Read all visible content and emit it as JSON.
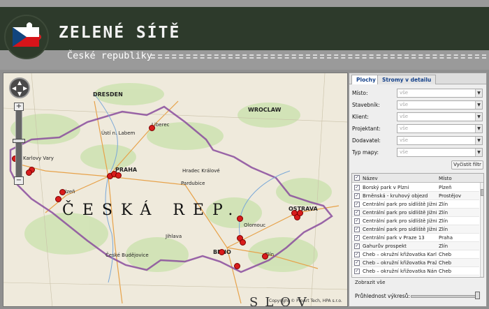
{
  "header": {
    "title": "ZELENÉ SÍTĚ",
    "subtitle": "České republiky"
  },
  "map": {
    "country_label": "ČESKÁ REP.",
    "bottom_label": "SLOV",
    "copyright": "Copyright © ProArt Tech, HPA s.r.o.",
    "nav": {
      "up": "▲",
      "down": "▼",
      "left": "◀",
      "right": "▶"
    },
    "zoom": {
      "plus": "+",
      "minus": "−"
    },
    "cities": [
      "DRESDEN",
      "WROCLAW",
      "Ústí n. Labem",
      "Liberec",
      "Karlovy Vary",
      "PRAHA",
      "Hradec Králové",
      "Pardubice",
      "Plzeň",
      "Jihlava",
      "České Budějovice",
      "BRNO",
      "Olomouc",
      "OSTRAVA",
      "Zlín"
    ]
  },
  "panel": {
    "tabs": [
      "Plochy",
      "Stromy v detailu"
    ],
    "filters": [
      {
        "label": "Místo:",
        "value": "vše"
      },
      {
        "label": "Stavebník:",
        "value": "vše"
      },
      {
        "label": "Klient:",
        "value": "vše"
      },
      {
        "label": "Projektant:",
        "value": "vše"
      },
      {
        "label": "Dodavatel:",
        "value": "vše"
      },
      {
        "label": "Typ mapy:",
        "value": "vše"
      }
    ],
    "filter_button": "Vyčistit filtr",
    "grid": {
      "headers": {
        "name": "Název",
        "place": "Místo"
      },
      "rows": [
        {
          "name": "Borský park v Plzni",
          "place": "Plzeň"
        },
        {
          "name": "Brněnská - kruhový objezd",
          "place": "Prostějov"
        },
        {
          "name": "Centrální park pro sídliště Jižní S...",
          "place": "Zlín"
        },
        {
          "name": "Centrální park pro sídliště Jižní S...",
          "place": "Zlín"
        },
        {
          "name": "Centrální park pro sídliště Jižní S...",
          "place": "Zlín"
        },
        {
          "name": "Centrální park pro sídliště Jižní S...",
          "place": "Zlín"
        },
        {
          "name": "Centrální park v Praze 13",
          "place": "Praha"
        },
        {
          "name": "Gahurův prospekt",
          "place": "Zlín"
        },
        {
          "name": "Cheb – okružní křižovatka Karlo...",
          "place": "Cheb"
        },
        {
          "name": "Cheb – okružní křižovatka Pražská",
          "place": "Cheb"
        },
        {
          "name": "Cheb – okružní křižovatka Nám...",
          "place": "Cheb"
        }
      ]
    },
    "show_all": "Zobrazit vše",
    "opacity_label": "Průhlednost výkresů:",
    "opacity_value": 1.0
  },
  "colors": {
    "header_band": "#2d3a2b",
    "marker": "#d81c1c",
    "border_purple": "#8a4c9e",
    "tab_text": "#15428b"
  }
}
